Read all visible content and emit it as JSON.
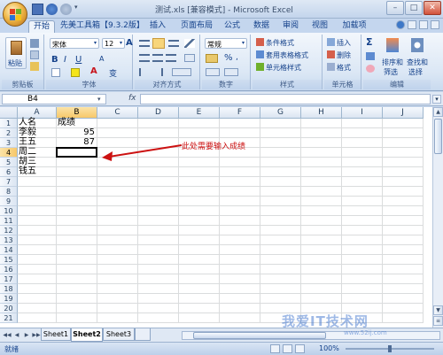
{
  "window": {
    "title": "测试.xls  [兼容模式] - Microsoft Excel"
  },
  "tabs": [
    "开始",
    "先美工具箱【9.3.2版】",
    "插入",
    "页面布局",
    "公式",
    "数据",
    "审阅",
    "视图",
    "加载项"
  ],
  "ribbon": {
    "clipboard": {
      "paste": "粘贴",
      "label": "剪贴板"
    },
    "font": {
      "name": "宋体",
      "size": "12",
      "bold": "B",
      "italic": "I",
      "underline": "U",
      "grow": "A",
      "shrink": "A",
      "color": "A",
      "phonetic": "变",
      "label": "字体"
    },
    "alignment": {
      "label": "对齐方式"
    },
    "number": {
      "format": "常规",
      "percent": "%",
      "label": "数字"
    },
    "styles": {
      "conditional": "条件格式",
      "table": "套用表格格式",
      "cell": "单元格样式",
      "label": "样式"
    },
    "cells": {
      "insert": "插入",
      "delete": "删除",
      "format": "格式",
      "label": "单元格"
    },
    "editing": {
      "sigma": "Σ",
      "sort": "排序和",
      "sort2": "筛选",
      "find": "查找和",
      "find2": "选择",
      "label": "编辑"
    }
  },
  "formula": {
    "namebox": "B4",
    "fx": "fx"
  },
  "columns": [
    "A",
    "B",
    "C",
    "D",
    "E",
    "F",
    "G",
    "H",
    "I",
    "J"
  ],
  "rows": [
    "1",
    "2",
    "3",
    "4",
    "5",
    "6",
    "7",
    "8",
    "9",
    "10",
    "11",
    "12",
    "13",
    "14",
    "15",
    "16",
    "17",
    "18",
    "19",
    "20",
    "21"
  ],
  "cells": {
    "A1": "人名",
    "B1": "成绩",
    "A2": "李毅",
    "B2": "95",
    "A3": "王五",
    "B3": "87",
    "A4": "周二",
    "A5": "胡三",
    "A6": "钱五"
  },
  "annotation": "此处需要输入成绩",
  "sheets": [
    "Sheet1",
    "Sheet2",
    "Sheet3"
  ],
  "status": {
    "ready": "就绪",
    "zoom": "100%"
  },
  "watermark": {
    "text": "我爱IT技术网",
    "sub": "www.52ij.com"
  },
  "colors": {
    "accent": "#15428b",
    "annotation": "#cc1111"
  }
}
